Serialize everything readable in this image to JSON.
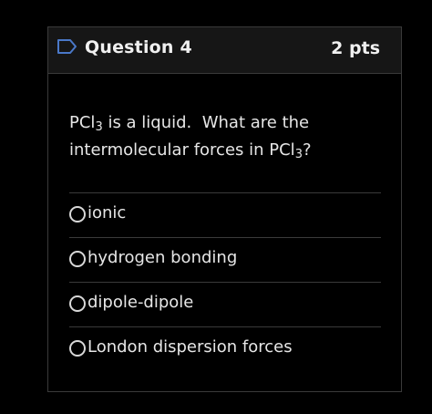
{
  "question": {
    "title": "Question 4",
    "points": "2 pts",
    "prompt": {
      "line1_before": "PCl",
      "line1_sub": "3",
      "line1_after": " is a liquid.  What are the",
      "line2_before": "intermolecular forces in PCl",
      "line2_sub": "3",
      "line2_after": "?"
    }
  },
  "answers": [
    {
      "label": "ionic",
      "selected": false
    },
    {
      "label": "hydrogen bonding",
      "selected": false
    },
    {
      "label": "dipole-dipole",
      "selected": false
    },
    {
      "label": "London dispersion forces",
      "selected": false
    }
  ],
  "colors": {
    "background": "#000000",
    "header": "#161616",
    "border": "#3a3a3a",
    "text": "#e6e6e6",
    "flag_outline": "#4a78c8"
  },
  "icons": {
    "flag": "flag-icon"
  }
}
